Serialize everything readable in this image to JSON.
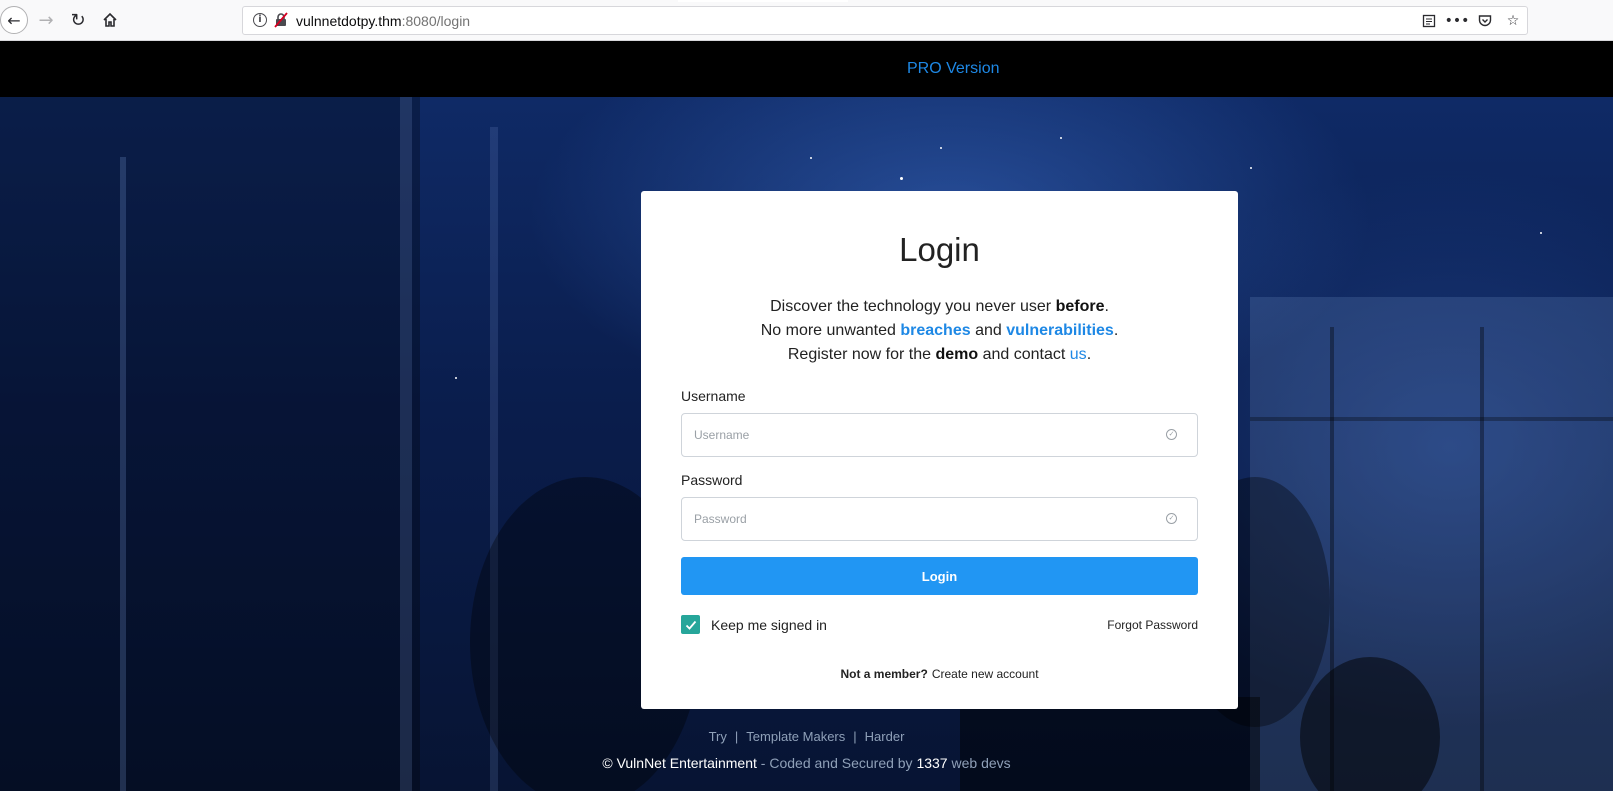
{
  "browser": {
    "url_host": "vulnnetdotpy.thm",
    "url_rest": ":8080/login"
  },
  "topnav": {
    "pro_label": "PRO Version"
  },
  "card": {
    "title": "Login",
    "desc": {
      "line1_a": "Discover the technology you never user ",
      "line1_b": "before",
      "line1_c": ".",
      "line2_a": "No more unwanted ",
      "line2_b": "breaches",
      "line2_c": " and ",
      "line2_d": "vulnerabilities",
      "line2_e": ".",
      "line3_a": "Register now for the ",
      "line3_b": "demo",
      "line3_c": " and contact ",
      "line3_d": "us",
      "line3_e": "."
    },
    "username_label": "Username",
    "username_placeholder": "Username",
    "password_label": "Password",
    "password_placeholder": "Password",
    "login_button": "Login",
    "keep_signed_in": "Keep me signed in",
    "keep_checked": true,
    "forgot_password": "Forgot Password",
    "not_member": "Not a member?",
    "create_account": "Create new account"
  },
  "footer": {
    "links": [
      "Try",
      "Template Makers",
      "Harder"
    ],
    "copy_symbol": "©",
    "company": "VulnNet Entertainment",
    "coded_text": " - Coded and Secured by ",
    "team": "1337",
    "devs_text": " web devs"
  },
  "colors": {
    "accent": "#2196f3",
    "checkbox": "#26a69a",
    "link": "#1e88e5"
  }
}
